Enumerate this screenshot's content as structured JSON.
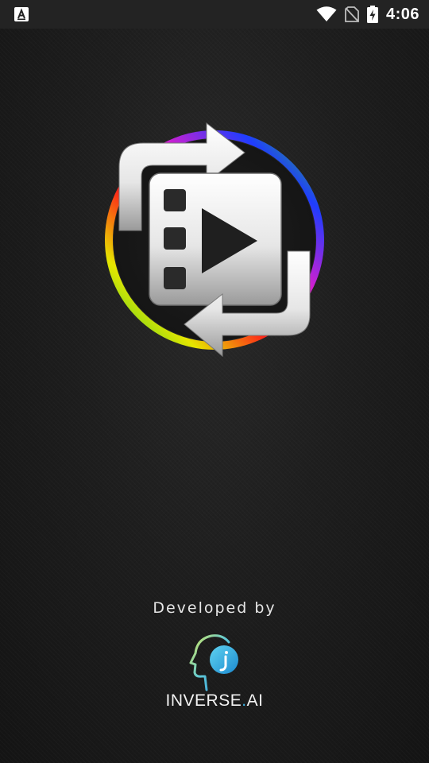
{
  "status_bar": {
    "time": "4:06",
    "icons": [
      "app-notification-icon",
      "wifi-icon",
      "no-sim-icon",
      "battery-charging-icon"
    ]
  },
  "splash": {
    "logo_icon": "video-rotate-icon",
    "developed_by": "Developed by",
    "developer": {
      "name_part1": "INVERSE",
      "dot": ".",
      "name_part2": "AI",
      "logo_icon": "inverse-ai-head-icon"
    }
  },
  "colors": {
    "background": "#1b1b1b",
    "ring_red": "#ff1a1a",
    "ring_yellow": "#e6e600",
    "ring_green": "#2ecc2e",
    "ring_blue": "#1f3dff",
    "ring_violet": "#a31fff",
    "brand_cyan": "#3ab3e6"
  }
}
